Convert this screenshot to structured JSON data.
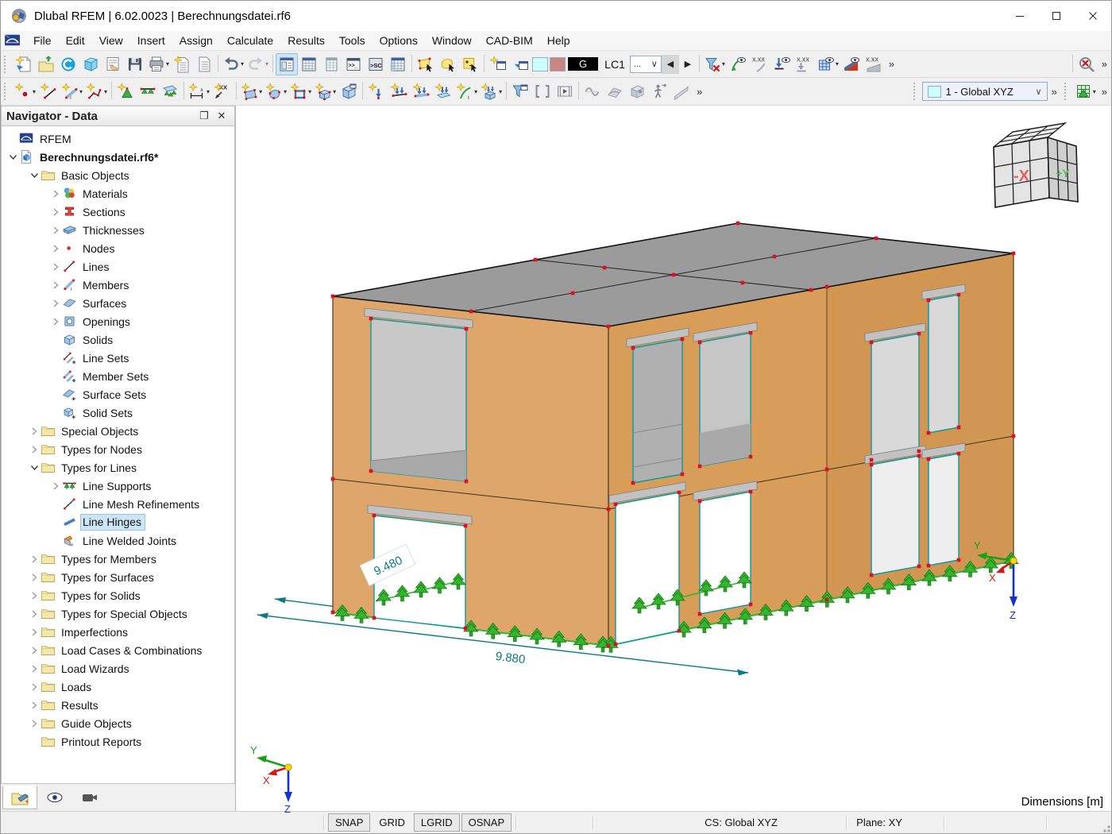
{
  "window": {
    "title": "Dlubal RFEM | 6.02.0023 | Berechnungsdatei.rf6"
  },
  "menu": {
    "items": [
      "File",
      "Edit",
      "View",
      "Insert",
      "Assign",
      "Calculate",
      "Results",
      "Tools",
      "Options",
      "Window",
      "CAD-BIM",
      "Help"
    ]
  },
  "toolbar_row1": [
    {
      "t": "grip"
    },
    {
      "t": "btn",
      "icon": "new-project"
    },
    {
      "t": "btn",
      "icon": "open-file"
    },
    {
      "t": "btn",
      "icon": "dlubal-center"
    },
    {
      "t": "btn",
      "icon": "open-model"
    },
    {
      "t": "btn",
      "icon": "project-navigator"
    },
    {
      "t": "btn",
      "icon": "save"
    },
    {
      "t": "btn",
      "icon": "print",
      "dd": true
    },
    {
      "t": "btn",
      "icon": "new-printout-report"
    },
    {
      "t": "btn",
      "icon": "printout-report"
    },
    {
      "t": "sep"
    },
    {
      "t": "btn",
      "icon": "undo",
      "dd": true
    },
    {
      "t": "btn",
      "icon": "redo",
      "dd": true,
      "disabled": true
    },
    {
      "t": "sep"
    },
    {
      "t": "btn",
      "icon": "navigator-panel",
      "active": true
    },
    {
      "t": "btn",
      "icon": "tables"
    },
    {
      "t": "btn",
      "icon": "table-panel"
    },
    {
      "t": "btn",
      "icon": "console"
    },
    {
      "t": "btn",
      "icon": "script-console"
    },
    {
      "t": "btn",
      "icon": "result-tables"
    },
    {
      "t": "sep"
    },
    {
      "t": "btn",
      "icon": "select-window"
    },
    {
      "t": "btn",
      "icon": "select-special"
    },
    {
      "t": "btn",
      "icon": "select-add-remove"
    },
    {
      "t": "sep"
    },
    {
      "t": "btn",
      "icon": "new-visibility"
    },
    {
      "t": "btn",
      "icon": "visibility-by-window"
    },
    {
      "t": "swatch",
      "name": "background-color-swatch",
      "color": "#ccfefe"
    },
    {
      "t": "swatch",
      "name": "object-color-swatch",
      "color": "#c98585"
    },
    {
      "t": "chip-g"
    },
    {
      "t": "chip-lc"
    },
    {
      "t": "combo-more"
    },
    {
      "t": "arrow-prev"
    },
    {
      "t": "arrow-next"
    },
    {
      "t": "sep"
    },
    {
      "t": "btn",
      "icon": "filter-loads",
      "dd": true
    },
    {
      "t": "btn",
      "icon": "show-loads"
    },
    {
      "t": "btn",
      "icon": "show-load-values"
    },
    {
      "t": "btn",
      "icon": "show-supports"
    },
    {
      "t": "btn",
      "icon": "show-support-values"
    },
    {
      "t": "btn",
      "icon": "show-mesh",
      "dd": true
    },
    {
      "t": "btn",
      "icon": "show-results"
    },
    {
      "t": "btn",
      "icon": "show-result-values"
    },
    {
      "t": "overflow"
    },
    {
      "t": "sep",
      "right": true
    },
    {
      "t": "btn",
      "icon": "zoom-reset",
      "right": true
    },
    {
      "t": "overflow",
      "right": true
    }
  ],
  "toolbar_row2": [
    {
      "t": "grip"
    },
    {
      "t": "btn",
      "icon": "new-node",
      "dd": true
    },
    {
      "t": "btn",
      "icon": "new-line"
    },
    {
      "t": "btn",
      "icon": "new-member",
      "dd": true
    },
    {
      "t": "btn",
      "icon": "new-polyline",
      "dd": true
    },
    {
      "t": "sep"
    },
    {
      "t": "btn",
      "icon": "new-nodal-support"
    },
    {
      "t": "btn",
      "icon": "new-line-support"
    },
    {
      "t": "btn",
      "icon": "new-surface-support"
    },
    {
      "t": "sep"
    },
    {
      "t": "btn",
      "icon": "new-dimension",
      "dd": true
    },
    {
      "t": "btn",
      "icon": "new-dimension-xx"
    },
    {
      "t": "sep"
    },
    {
      "t": "btn",
      "icon": "new-surface",
      "dd": true
    },
    {
      "t": "btn",
      "icon": "new-opening",
      "dd": true
    },
    {
      "t": "btn",
      "icon": "new-rectangular-surface",
      "dd": true
    },
    {
      "t": "btn",
      "icon": "new-solid",
      "dd": true
    },
    {
      "t": "btn",
      "icon": "new-block"
    },
    {
      "t": "sep"
    },
    {
      "t": "btn",
      "icon": "new-nodal-load"
    },
    {
      "t": "btn",
      "icon": "new-line-load"
    },
    {
      "t": "btn",
      "icon": "new-member-load"
    },
    {
      "t": "btn",
      "icon": "new-surface-load"
    },
    {
      "t": "btn",
      "icon": "new-free-line-load",
      "dd": true
    },
    {
      "t": "btn",
      "icon": "new-solid-load",
      "dd": true
    },
    {
      "t": "sep"
    },
    {
      "t": "btn",
      "icon": "filter-panel"
    },
    {
      "t": "btn",
      "icon": "clipping-planes"
    },
    {
      "t": "btn",
      "icon": "animation"
    },
    {
      "t": "sep"
    },
    {
      "t": "btn",
      "icon": "results-members"
    },
    {
      "t": "btn",
      "icon": "results-surfaces"
    },
    {
      "t": "btn",
      "icon": "results-solids"
    },
    {
      "t": "btn",
      "icon": "walkthrough"
    },
    {
      "t": "btn",
      "icon": "results-sections"
    },
    {
      "t": "overflow"
    },
    {
      "t": "grip",
      "right": true
    },
    {
      "t": "cs-combo",
      "right": true
    },
    {
      "t": "overflow",
      "right": true
    },
    {
      "t": "grip",
      "right": true
    },
    {
      "t": "btn",
      "icon": "mesh-settings",
      "dd": true,
      "right": true
    },
    {
      "t": "overflow",
      "right": true
    }
  ],
  "loadcase": {
    "category": "G",
    "case": "LC1",
    "more": "..."
  },
  "cs_combo": {
    "value": "1 - Global XYZ"
  },
  "navigator": {
    "title": "Navigator - Data",
    "tree": [
      {
        "label": "RFEM",
        "level": 0,
        "chev": "",
        "icon": "rfem"
      },
      {
        "label": "Berechnungsdatei.rf6*",
        "level": 0,
        "chev": "v",
        "icon": "model",
        "bold": true
      },
      {
        "label": "Basic Objects",
        "level": 1,
        "chev": "v",
        "icon": "folder"
      },
      {
        "label": "Materials",
        "level": 2,
        "chev": ">",
        "icon": "materials"
      },
      {
        "label": "Sections",
        "level": 2,
        "chev": ">",
        "icon": "sections"
      },
      {
        "label": "Thicknesses",
        "level": 2,
        "chev": ">",
        "icon": "thicknesses"
      },
      {
        "label": "Nodes",
        "level": 2,
        "chev": ">",
        "icon": "nodes"
      },
      {
        "label": "Lines",
        "level": 2,
        "chev": ">",
        "icon": "lines"
      },
      {
        "label": "Members",
        "level": 2,
        "chev": ">",
        "icon": "members"
      },
      {
        "label": "Surfaces",
        "level": 2,
        "chev": ">",
        "icon": "surfaces"
      },
      {
        "label": "Openings",
        "level": 2,
        "chev": ">",
        "icon": "openings"
      },
      {
        "label": "Solids",
        "level": 2,
        "chev": "",
        "icon": "solids"
      },
      {
        "label": "Line Sets",
        "level": 2,
        "chev": "",
        "icon": "line-sets"
      },
      {
        "label": "Member Sets",
        "level": 2,
        "chev": "",
        "icon": "member-sets"
      },
      {
        "label": "Surface Sets",
        "level": 2,
        "chev": "",
        "icon": "surface-sets"
      },
      {
        "label": "Solid Sets",
        "level": 2,
        "chev": "",
        "icon": "solid-sets"
      },
      {
        "label": "Special Objects",
        "level": 1,
        "chev": ">",
        "icon": "folder"
      },
      {
        "label": "Types for Nodes",
        "level": 1,
        "chev": ">",
        "icon": "folder"
      },
      {
        "label": "Types for Lines",
        "level": 1,
        "chev": "v",
        "icon": "folder"
      },
      {
        "label": "Line Supports",
        "level": 2,
        "chev": ">",
        "icon": "line-supports"
      },
      {
        "label": "Line Mesh Refinements",
        "level": 2,
        "chev": "",
        "icon": "line-mesh-refinements"
      },
      {
        "label": "Line Hinges",
        "level": 2,
        "chev": "",
        "icon": "line-hinges",
        "selected": true
      },
      {
        "label": "Line Welded Joints",
        "level": 2,
        "chev": "",
        "icon": "line-welded-joints"
      },
      {
        "label": "Types for Members",
        "level": 1,
        "chev": ">",
        "icon": "folder"
      },
      {
        "label": "Types for Surfaces",
        "level": 1,
        "chev": ">",
        "icon": "folder"
      },
      {
        "label": "Types for Solids",
        "level": 1,
        "chev": ">",
        "icon": "folder"
      },
      {
        "label": "Types for Special Objects",
        "level": 1,
        "chev": ">",
        "icon": "folder"
      },
      {
        "label": "Imperfections",
        "level": 1,
        "chev": ">",
        "icon": "folder"
      },
      {
        "label": "Load Cases & Combinations",
        "level": 1,
        "chev": ">",
        "icon": "folder"
      },
      {
        "label": "Load Wizards",
        "level": 1,
        "chev": ">",
        "icon": "folder"
      },
      {
        "label": "Loads",
        "level": 1,
        "chev": ">",
        "icon": "folder"
      },
      {
        "label": "Results",
        "level": 1,
        "chev": ">",
        "icon": "folder"
      },
      {
        "label": "Guide Objects",
        "level": 1,
        "chev": ">",
        "icon": "folder"
      },
      {
        "label": "Printout Reports",
        "level": 1,
        "chev": "",
        "icon": "folder"
      }
    ]
  },
  "viewport": {
    "dim1": "9.480",
    "dim2": "9.880",
    "dimensions_label": "Dimensions [m]",
    "axis": {
      "x": "X",
      "y": "Y",
      "z": "Z"
    },
    "cube": {
      "left": "-X",
      "right": "+Y"
    },
    "colors": {
      "wall_sw": "#dfa66b",
      "wall_se": "#d19652",
      "roof": "#9b9b9b",
      "support": "#35b52f",
      "node": "#e01020",
      "dimension": "#0c7a85"
    }
  },
  "statusbar": {
    "toggles": [
      {
        "label": "SNAP",
        "on": true
      },
      {
        "label": "GRID",
        "on": false
      },
      {
        "label": "LGRID",
        "on": true
      },
      {
        "label": "OSNAP",
        "on": true
      }
    ],
    "cs": "CS: Global XYZ",
    "plane": "Plane: XY"
  }
}
